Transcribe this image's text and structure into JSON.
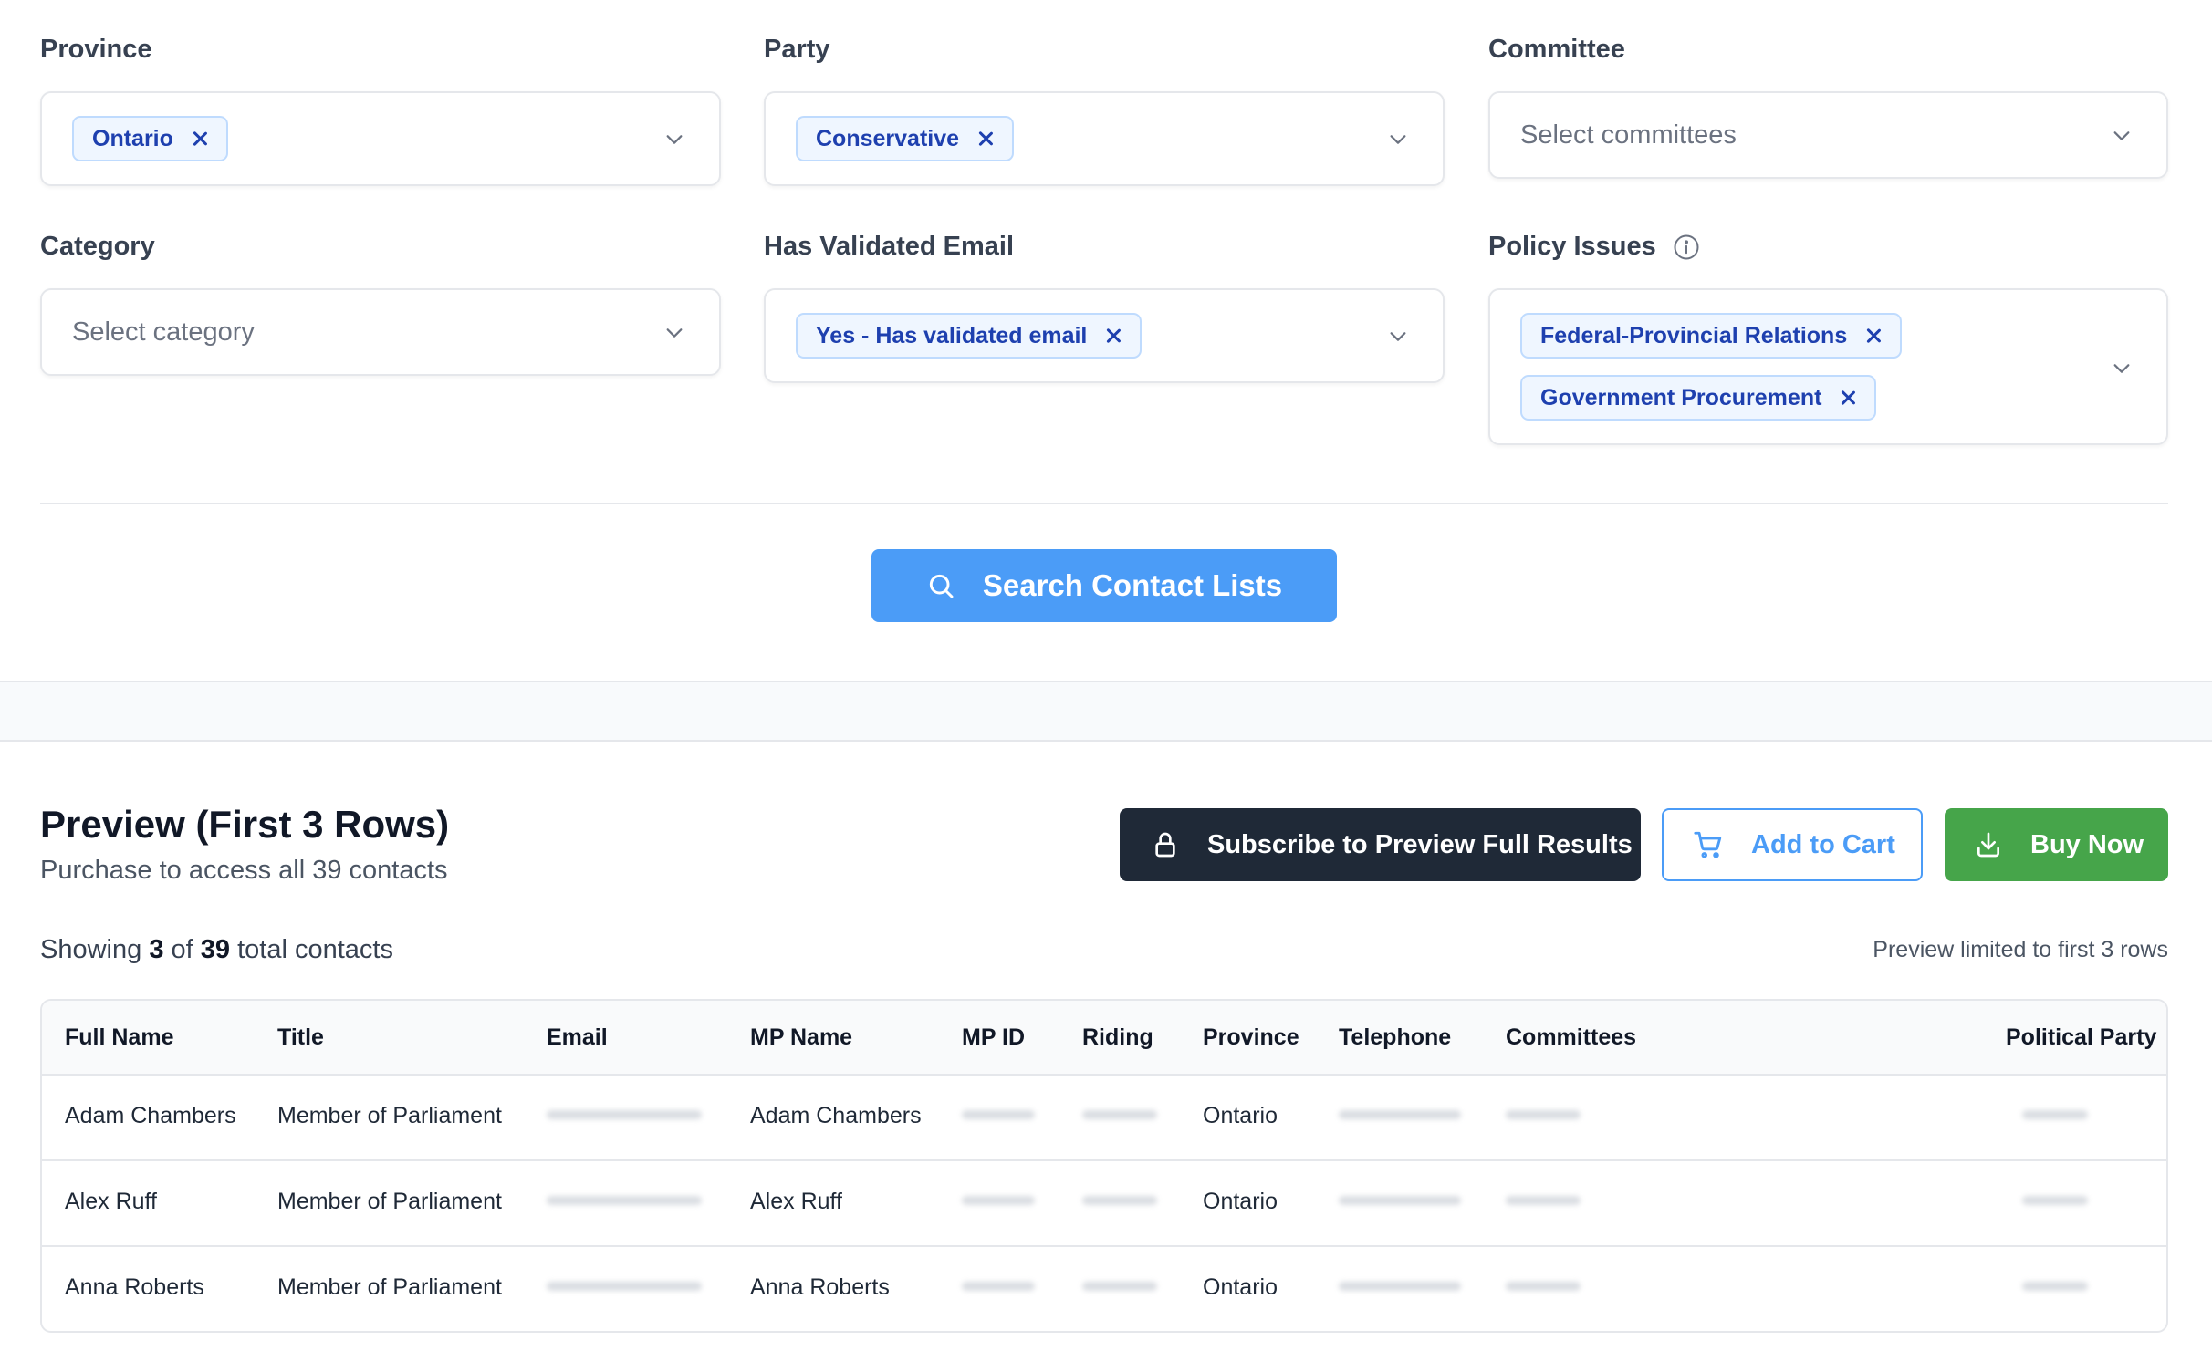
{
  "filters": {
    "province": {
      "label": "Province",
      "chips": [
        "Ontario"
      ]
    },
    "party": {
      "label": "Party",
      "chips": [
        "Conservative"
      ]
    },
    "committee": {
      "label": "Committee",
      "placeholder": "Select committees"
    },
    "category": {
      "label": "Category",
      "placeholder": "Select category"
    },
    "validated_email": {
      "label": "Has Validated Email",
      "chips": [
        "Yes - Has validated email"
      ]
    },
    "policy_issues": {
      "label": "Policy Issues",
      "chips": [
        "Federal-Provincial Relations",
        "Government Procurement"
      ]
    }
  },
  "search_button": {
    "label": "Search Contact Lists"
  },
  "preview": {
    "title": "Preview (First 3 Rows)",
    "subtitle": "Purchase to access all 39 contacts",
    "subscribe_label": "Subscribe to Preview Full Results",
    "add_to_cart_label": "Add to Cart",
    "buy_now_label": "Buy Now",
    "showing_prefix": "Showing",
    "showing_count": "3",
    "showing_of": "of",
    "showing_total": "39",
    "showing_suffix": "total contacts",
    "limited_note": "Preview limited to first 3 rows"
  },
  "table": {
    "columns": [
      "Full Name",
      "Title",
      "Email",
      "MP Name",
      "MP ID",
      "Riding",
      "Province",
      "Telephone",
      "Committees",
      "Political Party"
    ],
    "rows": [
      {
        "full_name": "Adam Chambers",
        "title": "Member of Parliament",
        "mp_name": "Adam Chambers",
        "province": "Ontario"
      },
      {
        "full_name": "Alex Ruff",
        "title": "Member of Parliament",
        "mp_name": "Alex Ruff",
        "province": "Ontario"
      },
      {
        "full_name": "Anna Roberts",
        "title": "Member of Parliament",
        "mp_name": "Anna Roberts",
        "province": "Ontario"
      }
    ]
  },
  "colors": {
    "accent_blue": "#4b9cf7",
    "chip_text": "#1e40af",
    "dark_button": "#1f2937",
    "green_button": "#46a54a"
  }
}
